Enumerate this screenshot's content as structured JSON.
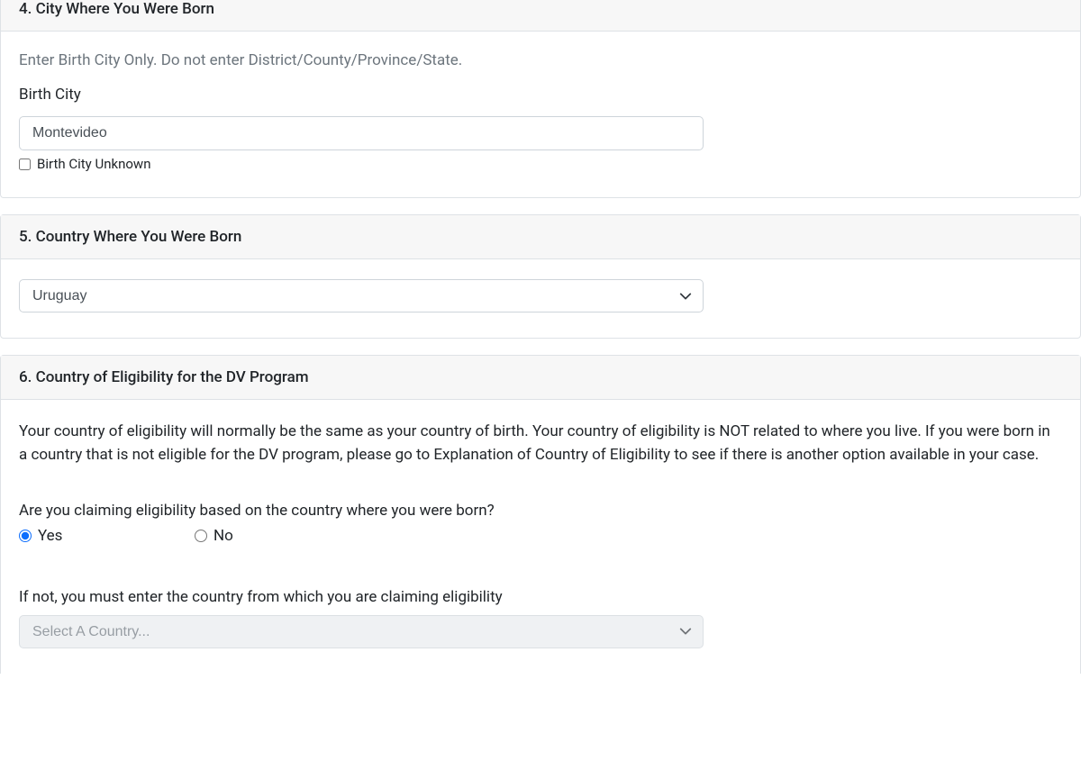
{
  "section4": {
    "title": "4. City Where You Were Born",
    "helper": "Enter Birth City Only. Do not enter District/County/Province/State.",
    "label": "Birth City",
    "value": "Montevideo",
    "checkboxLabel": "Birth City Unknown"
  },
  "section5": {
    "title": "5. Country Where You Were Born",
    "selected": "Uruguay"
  },
  "section6": {
    "title": "6. Country of Eligibility for the DV Program",
    "paragraph": "Your country of eligibility will normally be the same as your country of birth. Your country of eligibility is NOT related to where you live. If you were born in a country that is not eligible for the DV program, please go to Explanation of Country of Eligibility to see if there is another option available in your case.",
    "question": "Are you claiming eligibility based on the country where you were born?",
    "yesLabel": "Yes",
    "noLabel": "No",
    "eligibilityLabel": "If not, you must enter the country from which you are claiming eligibility",
    "eligibilityPlaceholder": "Select A Country..."
  }
}
